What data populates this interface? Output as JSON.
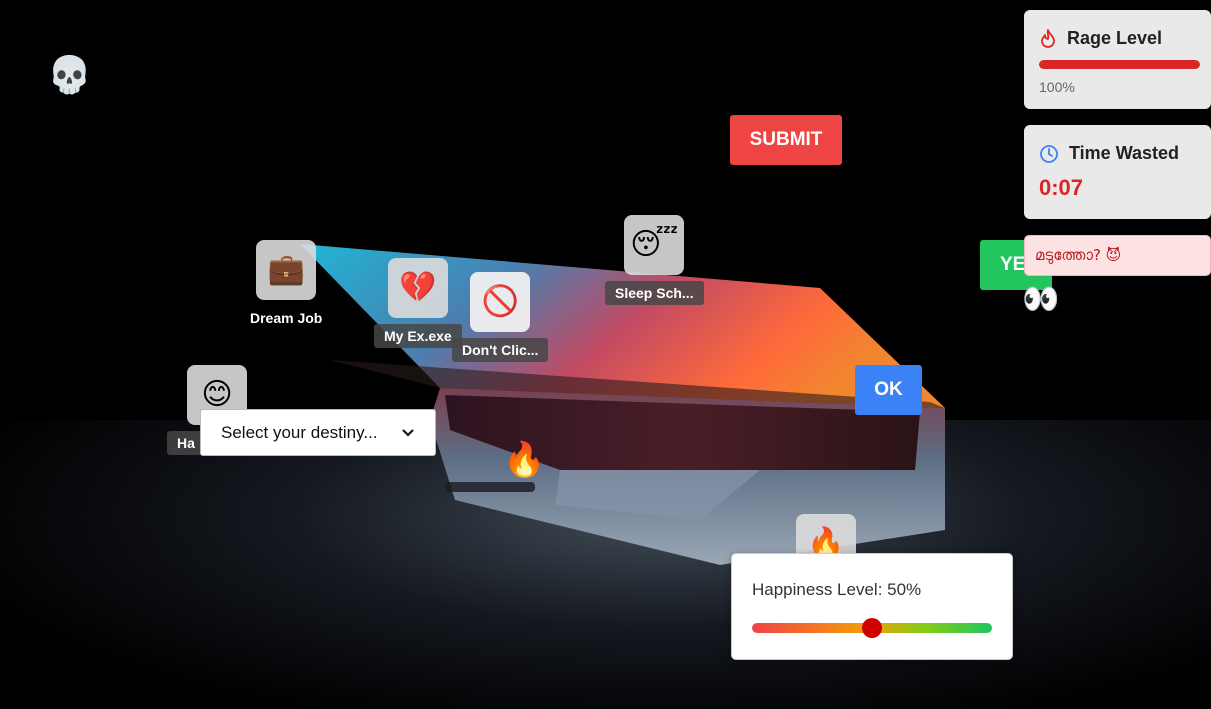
{
  "desktop_icons": [
    {
      "name": "dream-job",
      "emoji": "💼",
      "label": "Dream Job"
    },
    {
      "name": "my-ex",
      "emoji": "💔",
      "label": "My Ex.exe"
    },
    {
      "name": "dont-click",
      "emoji": "🚫",
      "label": "Don't Clic..."
    },
    {
      "name": "sleep-schedule",
      "emoji": "😴",
      "label": "Sleep Sch..."
    },
    {
      "name": "happiness",
      "emoji": "😊",
      "label": "Ha"
    },
    {
      "name": "fire-tile",
      "emoji": "🔥",
      "label": ""
    }
  ],
  "decor": {
    "skull": "💀",
    "fire": "🔥",
    "eyes": "👀"
  },
  "buttons": {
    "submit": "SUBMIT",
    "ok": "OK",
    "yes": "YES"
  },
  "select": {
    "placeholder": "Select your destiny..."
  },
  "rage": {
    "title": "Rage Level",
    "value_text": "100%",
    "level": 1.0
  },
  "time": {
    "title": "Time Wasted",
    "value": "0:07"
  },
  "toast": {
    "text": "മടുത്തോ? 😈"
  },
  "happiness": {
    "label": "Happiness Level: 50%",
    "level": 0.5
  },
  "colors": {
    "submit": "#ef4444",
    "ok": "#3b82f6",
    "yes": "#22c55e",
    "rage_bar": "#dc2626",
    "time_value": "#dc2626",
    "toast_bg": "#fde2e4",
    "toast_text": "#b91c1c"
  }
}
